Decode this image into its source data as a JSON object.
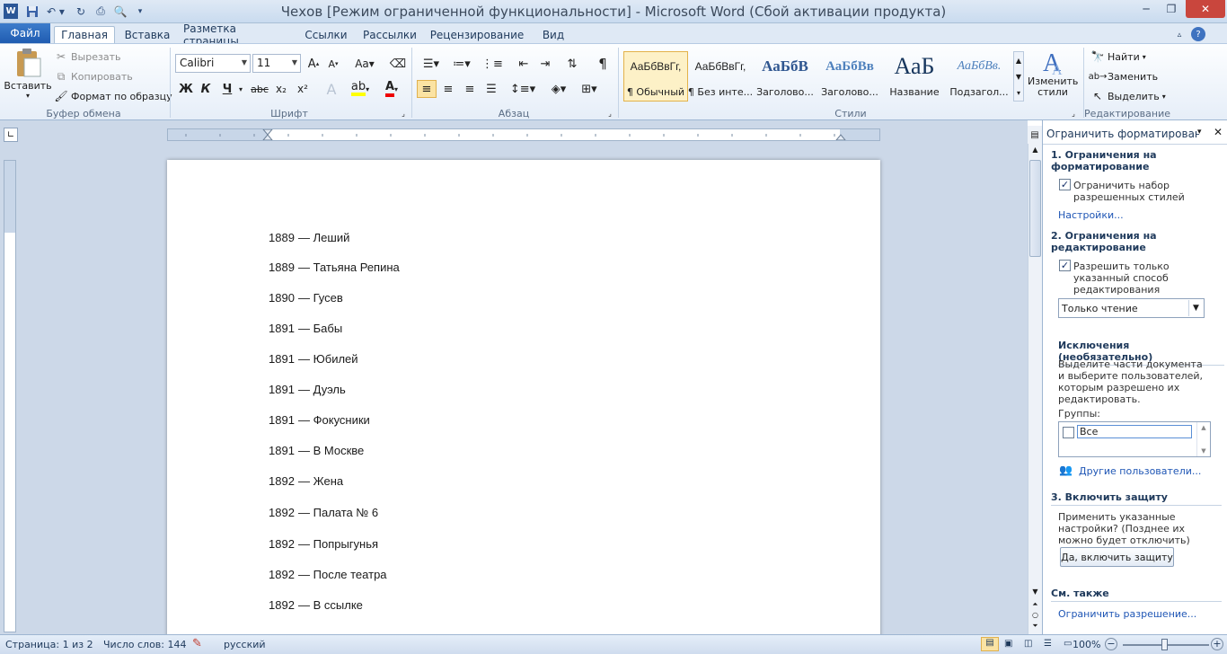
{
  "window": {
    "title": "Чехов [Режим ограниченной функциональности]  -  Microsoft Word (Сбой активации продукта)",
    "minimize": "─",
    "maximize": "❐",
    "close": "✕"
  },
  "tabs": {
    "file": "Файл",
    "items": [
      "Главная",
      "Вставка",
      "Разметка страницы",
      "Ссылки",
      "Рассылки",
      "Рецензирование",
      "Вид"
    ]
  },
  "ribbon": {
    "clipboard": {
      "paste": "Вставить",
      "cut": "Вырезать",
      "copy": "Копировать",
      "format_painter": "Формат по образцу",
      "label": "Буфер обмена"
    },
    "font": {
      "name": "Calibri",
      "size": "11",
      "label": "Шрифт",
      "bold": "Ж",
      "italic": "К",
      "underline": "Ч",
      "strike": "abc",
      "sub": "x₂",
      "sup": "x²"
    },
    "paragraph": {
      "label": "Абзац"
    },
    "styles": {
      "label": "Стили",
      "items": [
        {
          "preview": "АаБбВвГг,",
          "name": "¶ Обычный"
        },
        {
          "preview": "АаБбВвГг,",
          "name": "¶ Без инте..."
        },
        {
          "preview": "АаБбВ",
          "name": "Заголово..."
        },
        {
          "preview": "АаБбВв",
          "name": "Заголово..."
        },
        {
          "preview": "АаБ",
          "name": "Название"
        },
        {
          "preview": "АаБбВв.",
          "name": "Подзагол..."
        }
      ],
      "change": "Изменить стили"
    },
    "editing": {
      "find": "Найти",
      "replace": "Заменить",
      "select": "Выделить",
      "label": "Редактирование"
    }
  },
  "document": {
    "lines": [
      {
        "year": "1889",
        "title": "Леший"
      },
      {
        "year": "1889",
        "title": "Татьяна Репина"
      },
      {
        "year": "1890",
        "title": "Гусев"
      },
      {
        "year": "1891",
        "title": "Бабы"
      },
      {
        "year": "1891",
        "title": "Юбилей"
      },
      {
        "year": "1891",
        "title": "Дуэль"
      },
      {
        "year": "1891",
        "title": "Фокусники"
      },
      {
        "year": "1891",
        "title": "В Москве"
      },
      {
        "year": "1892",
        "title": "Жена"
      },
      {
        "year": "1892",
        "title": "Палата № 6"
      },
      {
        "year": "1892",
        "title": "Попрыгунья"
      },
      {
        "year": "1892",
        "title": "После театра"
      },
      {
        "year": "1892",
        "title": "В ссылке"
      }
    ],
    "dash": "—"
  },
  "pane": {
    "title": "Ограничить форматировани",
    "s1": "1. Ограничения на форматирование",
    "s1_check": "Ограничить набор разрешенных стилей",
    "settings": "Настройки...",
    "s2": "2. Ограничения на редактирование",
    "s2_check": "Разрешить только указанный способ редактирования документа:",
    "mode": "Только чтение",
    "exceptions": "Исключения (необязательно)",
    "exceptions_text": "Выделите части документа и выберите пользователей, которым разрешено их редактировать.",
    "groups": "Группы:",
    "group_all": "Все",
    "other_users": "Другие пользователи...",
    "s3": "3. Включить защиту",
    "s3_text": "Применить указанные настройки? (Позднее их можно будет отключить)",
    "enable": "Да, включить защиту",
    "see_also": "См. также",
    "restrict": "Ограничить разрешение..."
  },
  "status": {
    "page": "Страница: 1 из 2",
    "words": "Число слов: 144",
    "lang": "русский",
    "zoom": "100%"
  }
}
